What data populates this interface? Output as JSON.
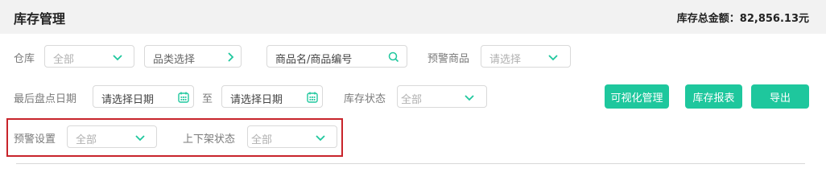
{
  "header": {
    "title": "库存管理",
    "total_label": "库存总金额：",
    "total_value": "82,856.13元"
  },
  "filters": {
    "warehouse": {
      "label": "仓库",
      "value": "全部"
    },
    "category": {
      "placeholder": "品类选择"
    },
    "product_search": {
      "placeholder": "商品名/商品编号"
    },
    "warning_product": {
      "label": "预警商品",
      "placeholder": "请选择"
    },
    "last_inventory_date": {
      "label": "最后盘点日期",
      "start_placeholder": "请选择日期",
      "to": "至",
      "end_placeholder": "请选择日期"
    },
    "stock_status": {
      "label": "库存状态",
      "value": "全部"
    },
    "warning_setting": {
      "label": "预警设置",
      "value": "全部"
    },
    "shelf_status": {
      "label": "上下架状态",
      "value": "全部"
    }
  },
  "actions": {
    "visual_manage": "可视化管理",
    "stock_report": "库存报表",
    "export": "导出"
  },
  "colors": {
    "accent": "#1ec79d",
    "highlight_border": "#c8242b",
    "header_bg": "#f2f2f2"
  },
  "icons": [
    "chevron-down-icon",
    "chevron-right-icon",
    "search-icon",
    "calendar-icon"
  ]
}
